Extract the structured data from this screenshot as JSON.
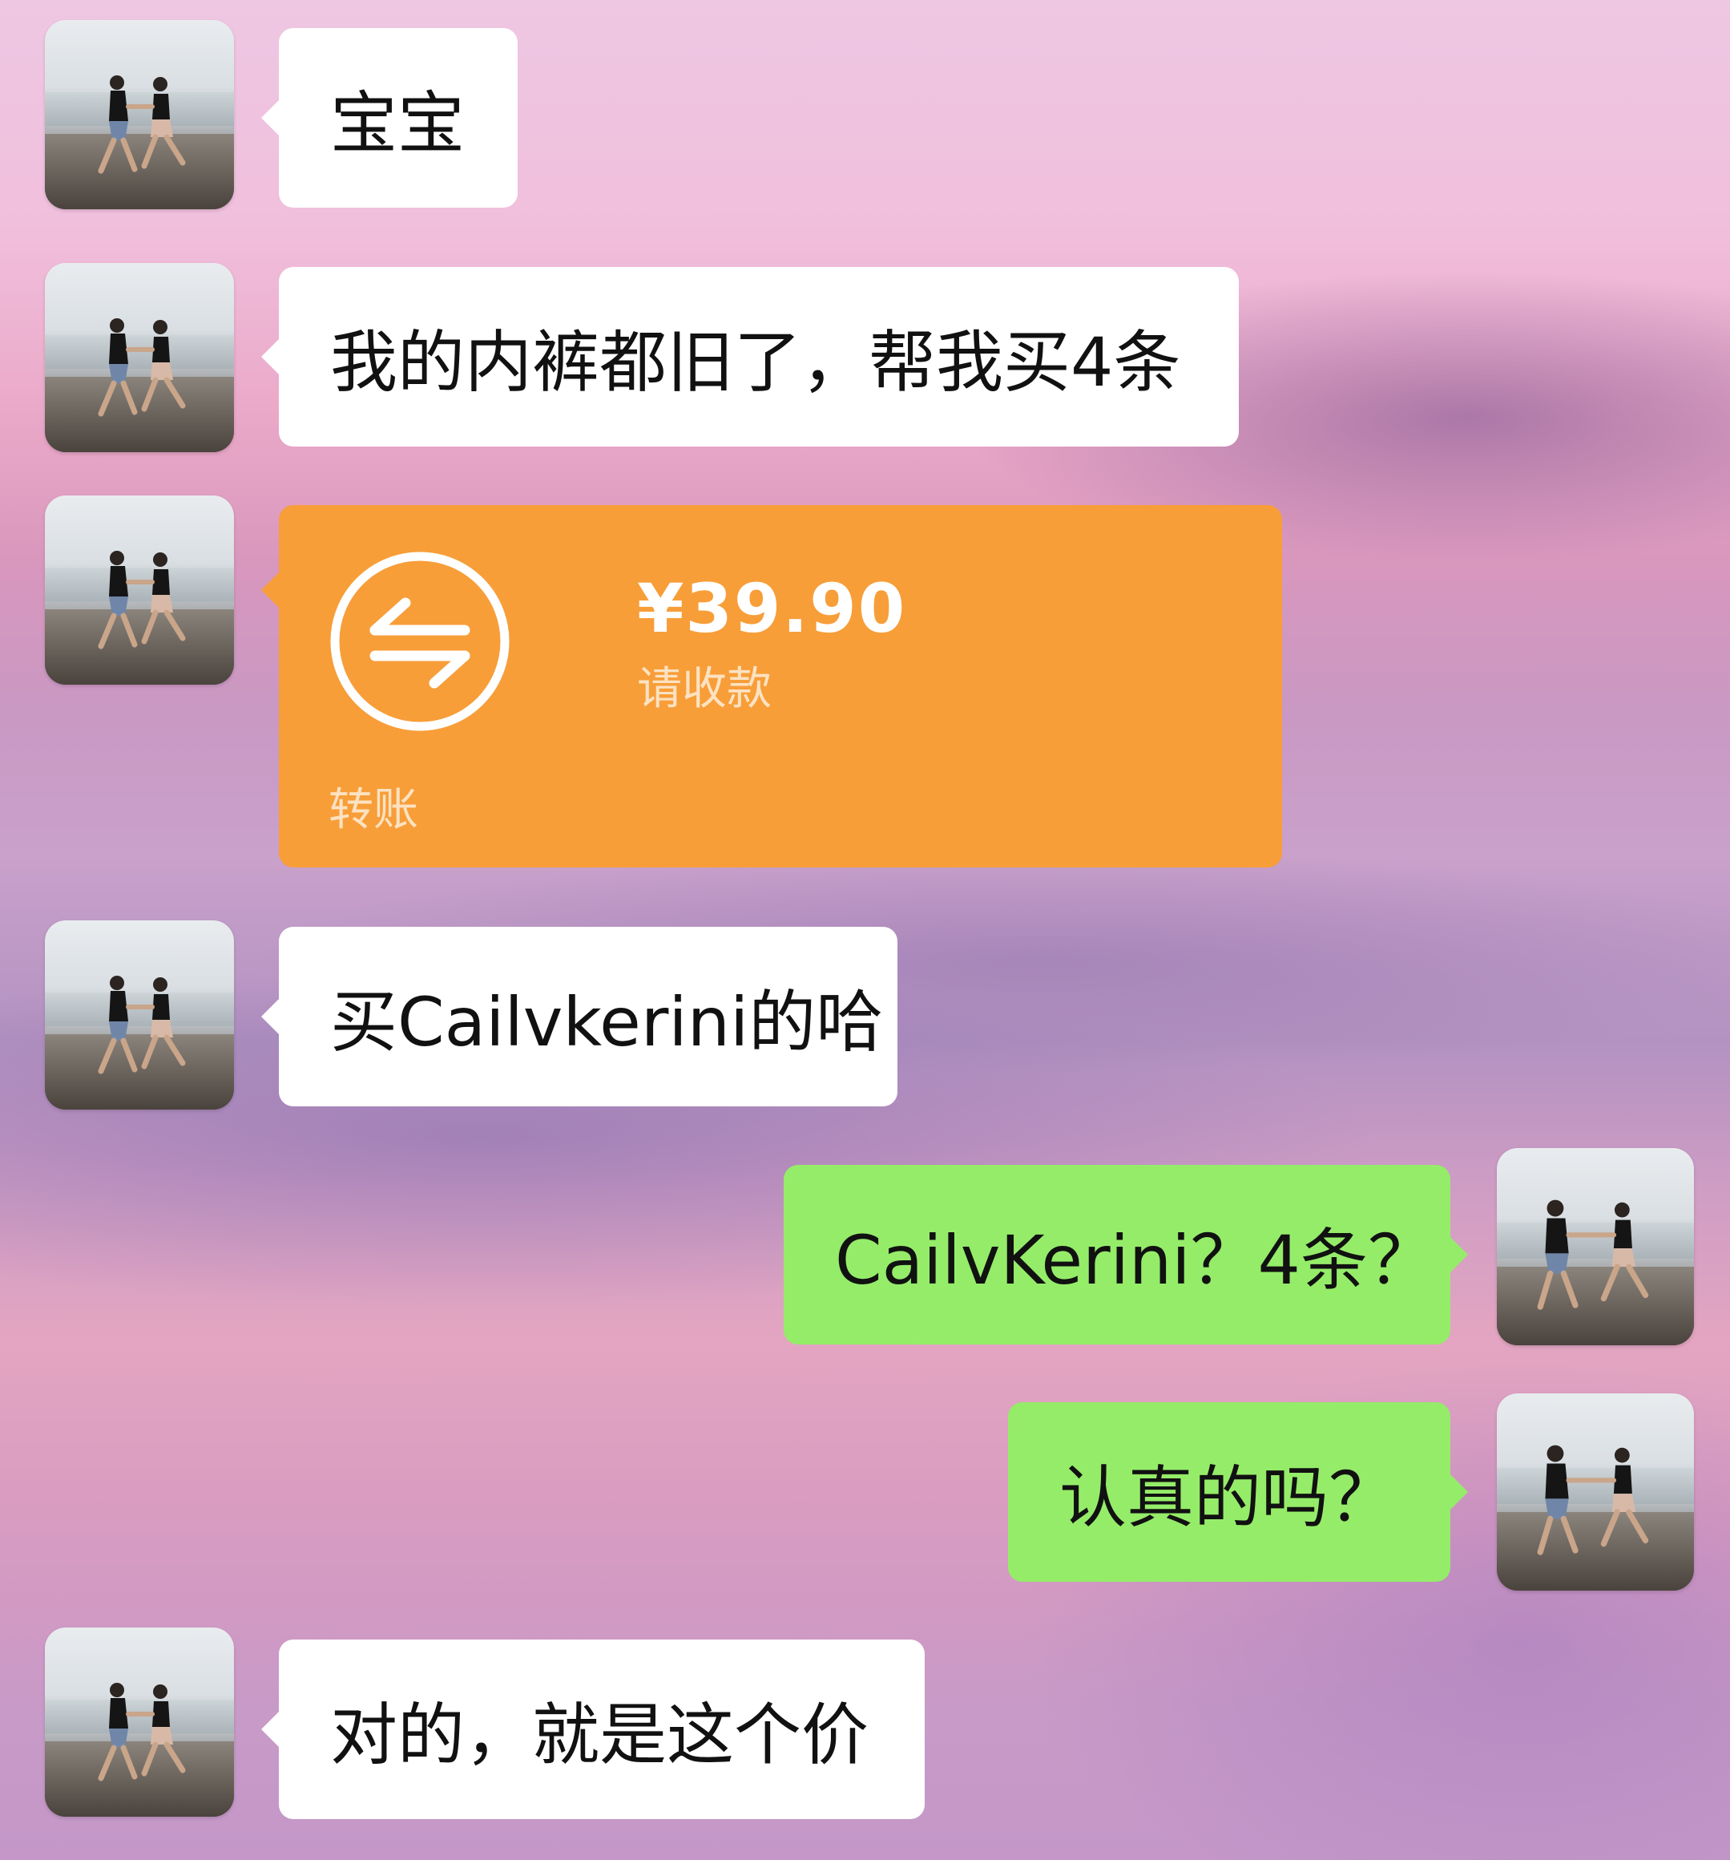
{
  "messages": [
    {
      "side": "left",
      "type": "text",
      "text": "宝宝"
    },
    {
      "side": "left",
      "type": "text",
      "text": "我的内裤都旧了，帮我买4条"
    },
    {
      "side": "left",
      "type": "transfer",
      "amount": "¥39.90",
      "status": "请收款",
      "footer": "转账",
      "icon": "transfer-arrows-icon",
      "color": "#f79e39"
    },
    {
      "side": "left",
      "type": "text",
      "text": "买Cailvkerini的哈"
    },
    {
      "side": "right",
      "type": "text",
      "text": "CailvKerini？4条？"
    },
    {
      "side": "right",
      "type": "text",
      "text": "认真的吗？"
    },
    {
      "side": "left",
      "type": "text",
      "text": "对的，就是这个价"
    }
  ],
  "colors": {
    "left_bubble": "#ffffff",
    "right_bubble": "#95ec69",
    "transfer_card": "#f79e39"
  }
}
